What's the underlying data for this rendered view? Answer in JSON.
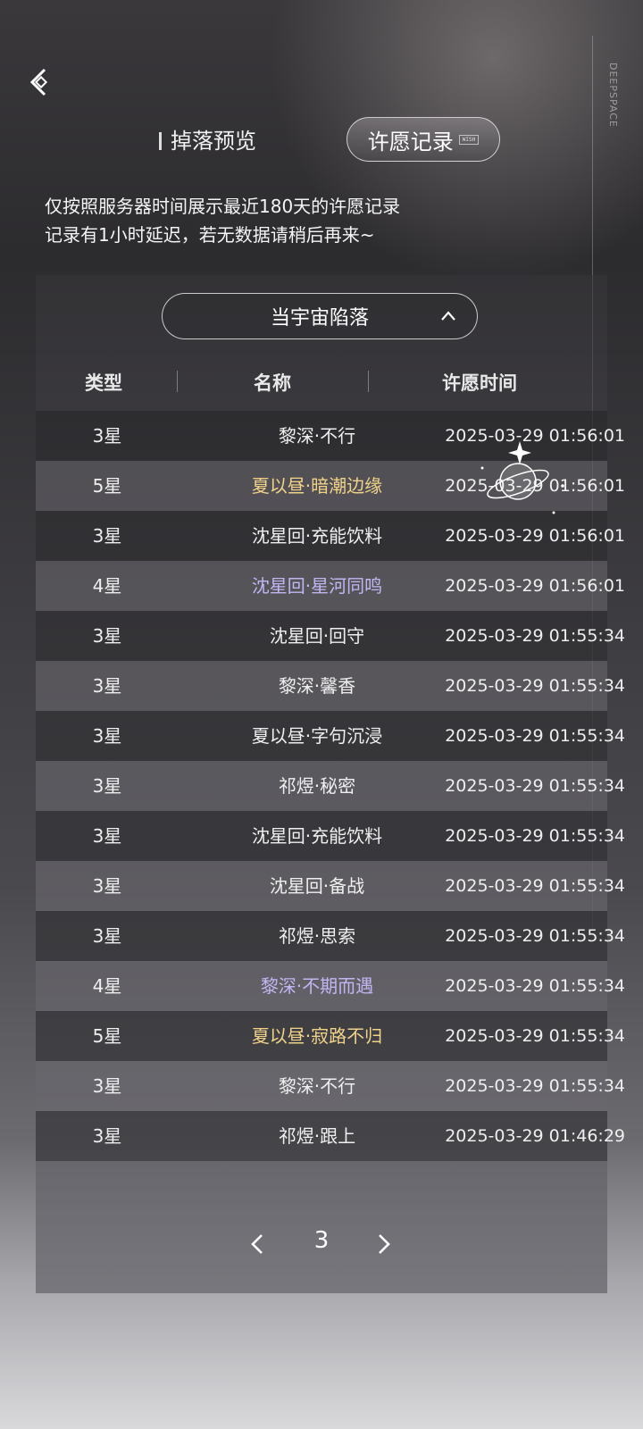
{
  "tabs": {
    "drop_preview": "掉落预览",
    "wish_record": "许愿记录",
    "wish_record_badge": "WISH"
  },
  "brand": "DEEPSPACE",
  "notice": {
    "line1": "仅按照服务器时间展示最近180天的许愿记录",
    "line2": "记录有1小时延迟，若无数据请稍后再来~"
  },
  "pool": {
    "selected": "当宇宙陷落"
  },
  "table": {
    "headers": {
      "type": "类型",
      "name": "名称",
      "time": "许愿时间"
    },
    "rows": [
      {
        "type": "3星",
        "name": "黎深·不行",
        "time": "2025-03-29 01:56:01",
        "rarity": "3"
      },
      {
        "type": "5星",
        "name": "夏以昼·暗潮边缘",
        "time": "2025-03-29 01:56:01",
        "rarity": "5"
      },
      {
        "type": "3星",
        "name": "沈星回·充能饮料",
        "time": "2025-03-29 01:56:01",
        "rarity": "3"
      },
      {
        "type": "4星",
        "name": "沈星回·星河同鸣",
        "time": "2025-03-29 01:56:01",
        "rarity": "4"
      },
      {
        "type": "3星",
        "name": "沈星回·回守",
        "time": "2025-03-29 01:55:34",
        "rarity": "3"
      },
      {
        "type": "3星",
        "name": "黎深·馨香",
        "time": "2025-03-29 01:55:34",
        "rarity": "3"
      },
      {
        "type": "3星",
        "name": "夏以昼·字句沉浸",
        "time": "2025-03-29 01:55:34",
        "rarity": "3"
      },
      {
        "type": "3星",
        "name": "祁煜·秘密",
        "time": "2025-03-29 01:55:34",
        "rarity": "3"
      },
      {
        "type": "3星",
        "name": "沈星回·充能饮料",
        "time": "2025-03-29 01:55:34",
        "rarity": "3"
      },
      {
        "type": "3星",
        "name": "沈星回·备战",
        "time": "2025-03-29 01:55:34",
        "rarity": "3"
      },
      {
        "type": "3星",
        "name": "祁煜·思索",
        "time": "2025-03-29 01:55:34",
        "rarity": "3"
      },
      {
        "type": "4星",
        "name": "黎深·不期而遇",
        "time": "2025-03-29 01:55:34",
        "rarity": "4"
      },
      {
        "type": "5星",
        "name": "夏以昼·寂路不归",
        "time": "2025-03-29 01:55:34",
        "rarity": "5"
      },
      {
        "type": "3星",
        "name": "黎深·不行",
        "time": "2025-03-29 01:55:34",
        "rarity": "3"
      },
      {
        "type": "3星",
        "name": "祁煜·跟上",
        "time": "2025-03-29 01:46:29",
        "rarity": "3"
      }
    ]
  },
  "pager": {
    "page": "3"
  },
  "colors": {
    "five_star": "#f0d28a",
    "four_star": "#c2b6f2",
    "three_star": "#efefef"
  }
}
